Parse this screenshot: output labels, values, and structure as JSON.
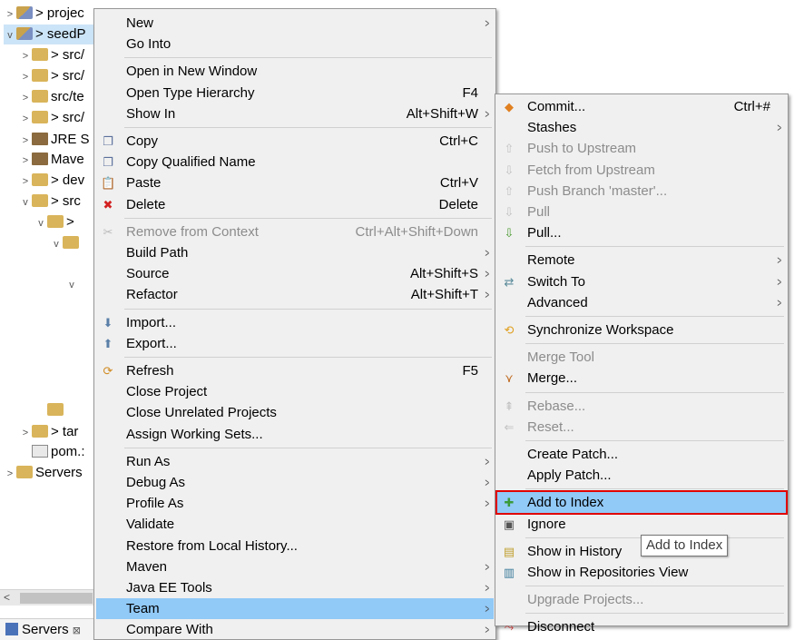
{
  "tree": {
    "rows": [
      {
        "label": "> projec",
        "icon": "project-icon",
        "twisty": ">",
        "indent": 0,
        "selected": false
      },
      {
        "label": "> seedP",
        "icon": "project-icon",
        "twisty": "v",
        "indent": 0,
        "selected": true
      },
      {
        "label": "> src/",
        "icon": "package-folder-icon",
        "twisty": ">",
        "indent": 1
      },
      {
        "label": "> src/",
        "icon": "package-folder-icon",
        "twisty": ">",
        "indent": 1
      },
      {
        "label": "src/te",
        "icon": "package-folder-icon",
        "twisty": ">",
        "indent": 1
      },
      {
        "label": "> src/",
        "icon": "package-folder-icon",
        "twisty": ">",
        "indent": 1
      },
      {
        "label": "JRE S",
        "icon": "library-icon",
        "twisty": ">",
        "indent": 1
      },
      {
        "label": "Mave",
        "icon": "library-icon",
        "twisty": ">",
        "indent": 1
      },
      {
        "label": "> dev",
        "icon": "folder-icon",
        "twisty": ">",
        "indent": 1
      },
      {
        "label": "> src",
        "icon": "folder-icon",
        "twisty": "v",
        "indent": 1
      },
      {
        "label": ">",
        "icon": "folder-icon",
        "twisty": "v",
        "indent": 2
      },
      {
        "label": "",
        "icon": "folder-icon",
        "twisty": "v",
        "indent": 3
      },
      {
        "label": "",
        "icon": "",
        "twisty": "v",
        "indent": 4
      },
      {
        "label": "",
        "icon": "folder-icon",
        "twisty": "",
        "indent": 2
      },
      {
        "label": "> tar",
        "icon": "folder-icon",
        "twisty": ">",
        "indent": 1
      },
      {
        "label": "pom.:",
        "icon": "file-icon",
        "twisty": "",
        "indent": 1
      },
      {
        "label": "Servers",
        "icon": "folder-icon",
        "twisty": ">",
        "indent": 0
      }
    ]
  },
  "bottom_tab": {
    "label": "Servers",
    "close": "⊠"
  },
  "menu_main": {
    "items": [
      {
        "label": "New",
        "accel": "",
        "submenu": true,
        "icon": "",
        "disabled": false
      },
      {
        "label": "Go Into",
        "accel": "",
        "submenu": false,
        "icon": "",
        "disabled": false
      },
      {
        "sep": true
      },
      {
        "label": "Open in New Window",
        "accel": "",
        "submenu": false,
        "icon": "",
        "disabled": false
      },
      {
        "label": "Open Type Hierarchy",
        "accel": "F4",
        "submenu": false,
        "icon": "",
        "disabled": false
      },
      {
        "label": "Show In",
        "accel": "Alt+Shift+W",
        "submenu": true,
        "icon": "",
        "disabled": false
      },
      {
        "sep": true
      },
      {
        "label": "Copy",
        "accel": "Ctrl+C",
        "submenu": false,
        "icon": "copy-icon",
        "disabled": false
      },
      {
        "label": "Copy Qualified Name",
        "accel": "",
        "submenu": false,
        "icon": "copy-icon",
        "disabled": false
      },
      {
        "label": "Paste",
        "accel": "Ctrl+V",
        "submenu": false,
        "icon": "paste-icon",
        "disabled": false
      },
      {
        "label": "Delete",
        "accel": "Delete",
        "submenu": false,
        "icon": "delete-icon",
        "disabled": false
      },
      {
        "sep": true
      },
      {
        "label": "Remove from Context",
        "accel": "Ctrl+Alt+Shift+Down",
        "submenu": false,
        "icon": "remove-context-icon",
        "disabled": true
      },
      {
        "label": "Build Path",
        "accel": "",
        "submenu": true,
        "icon": "",
        "disabled": false
      },
      {
        "label": "Source",
        "accel": "Alt+Shift+S",
        "submenu": true,
        "icon": "",
        "disabled": false
      },
      {
        "label": "Refactor",
        "accel": "Alt+Shift+T",
        "submenu": true,
        "icon": "",
        "disabled": false
      },
      {
        "sep": true
      },
      {
        "label": "Import...",
        "accel": "",
        "submenu": false,
        "icon": "import-icon",
        "disabled": false
      },
      {
        "label": "Export...",
        "accel": "",
        "submenu": false,
        "icon": "export-icon",
        "disabled": false
      },
      {
        "sep": true
      },
      {
        "label": "Refresh",
        "accel": "F5",
        "submenu": false,
        "icon": "refresh-icon",
        "disabled": false
      },
      {
        "label": "Close Project",
        "accel": "",
        "submenu": false,
        "icon": "",
        "disabled": false
      },
      {
        "label": "Close Unrelated Projects",
        "accel": "",
        "submenu": false,
        "icon": "",
        "disabled": false
      },
      {
        "label": "Assign Working Sets...",
        "accel": "",
        "submenu": false,
        "icon": "",
        "disabled": false
      },
      {
        "sep": true
      },
      {
        "label": "Run As",
        "accel": "",
        "submenu": true,
        "icon": "",
        "disabled": false
      },
      {
        "label": "Debug As",
        "accel": "",
        "submenu": true,
        "icon": "",
        "disabled": false
      },
      {
        "label": "Profile As",
        "accel": "",
        "submenu": true,
        "icon": "",
        "disabled": false
      },
      {
        "label": "Validate",
        "accel": "",
        "submenu": false,
        "icon": "",
        "disabled": false
      },
      {
        "label": "Restore from Local History...",
        "accel": "",
        "submenu": false,
        "icon": "",
        "disabled": false
      },
      {
        "label": "Maven",
        "accel": "",
        "submenu": true,
        "icon": "",
        "disabled": false
      },
      {
        "label": "Java EE Tools",
        "accel": "",
        "submenu": true,
        "icon": "",
        "disabled": false
      },
      {
        "label": "Team",
        "accel": "",
        "submenu": true,
        "icon": "",
        "disabled": false,
        "highlighted": true
      },
      {
        "label": "Compare With",
        "accel": "",
        "submenu": true,
        "icon": "",
        "disabled": false
      }
    ]
  },
  "menu_team": {
    "items": [
      {
        "label": "Commit...",
        "accel": "Ctrl+#",
        "submenu": false,
        "icon": "commit-icon",
        "disabled": false
      },
      {
        "label": "Stashes",
        "accel": "",
        "submenu": true,
        "icon": "",
        "disabled": false
      },
      {
        "label": "Push to Upstream",
        "accel": "",
        "submenu": false,
        "icon": "push-icon",
        "disabled": true
      },
      {
        "label": "Fetch from Upstream",
        "accel": "",
        "submenu": false,
        "icon": "fetch-icon",
        "disabled": true
      },
      {
        "label": "Push Branch 'master'...",
        "accel": "",
        "submenu": false,
        "icon": "push-branch-icon",
        "disabled": true
      },
      {
        "label": "Pull",
        "accel": "",
        "submenu": false,
        "icon": "pull-icon",
        "disabled": true
      },
      {
        "label": "Pull...",
        "accel": "",
        "submenu": false,
        "icon": "pull-dialog-icon",
        "disabled": false
      },
      {
        "sep": true
      },
      {
        "label": "Remote",
        "accel": "",
        "submenu": true,
        "icon": "",
        "disabled": false
      },
      {
        "label": "Switch To",
        "accel": "",
        "submenu": true,
        "icon": "switch-icon",
        "disabled": false
      },
      {
        "label": "Advanced",
        "accel": "",
        "submenu": true,
        "icon": "",
        "disabled": false
      },
      {
        "sep": true
      },
      {
        "label": "Synchronize Workspace",
        "accel": "",
        "submenu": false,
        "icon": "synchronize-icon",
        "disabled": false
      },
      {
        "sep": true
      },
      {
        "label": "Merge Tool",
        "accel": "",
        "submenu": false,
        "icon": "",
        "disabled": true
      },
      {
        "label": "Merge...",
        "accel": "",
        "submenu": false,
        "icon": "merge-icon",
        "disabled": false
      },
      {
        "sep": true
      },
      {
        "label": "Rebase...",
        "accel": "",
        "submenu": false,
        "icon": "rebase-icon",
        "disabled": true
      },
      {
        "label": "Reset...",
        "accel": "",
        "submenu": false,
        "icon": "reset-icon",
        "disabled": true
      },
      {
        "sep": true
      },
      {
        "label": "Create Patch...",
        "accel": "",
        "submenu": false,
        "icon": "",
        "disabled": false
      },
      {
        "label": "Apply Patch...",
        "accel": "",
        "submenu": false,
        "icon": "",
        "disabled": false
      },
      {
        "sep": true
      },
      {
        "label": "Add to Index",
        "accel": "",
        "submenu": false,
        "icon": "add-index-icon",
        "disabled": false,
        "boxed": true
      },
      {
        "label": "Ignore",
        "accel": "",
        "submenu": false,
        "icon": "ignore-icon",
        "disabled": false
      },
      {
        "sep": true
      },
      {
        "label": "Show in History",
        "accel": "",
        "submenu": false,
        "icon": "history-icon",
        "disabled": false
      },
      {
        "label": "Show in Repositories View",
        "accel": "",
        "submenu": false,
        "icon": "repositories-icon",
        "disabled": false
      },
      {
        "sep": true
      },
      {
        "label": "Upgrade Projects...",
        "accel": "",
        "submenu": false,
        "icon": "",
        "disabled": true
      },
      {
        "sep": true
      },
      {
        "label": "Disconnect",
        "accel": "",
        "submenu": false,
        "icon": "disconnect-icon",
        "disabled": false
      }
    ]
  },
  "tooltip": {
    "text": "Add to Index"
  },
  "colors": {
    "highlight": "#91c9f7",
    "focus_box": "#e00000",
    "menu_bg": "#f0f0f0",
    "disabled_text": "#8c8c8c"
  }
}
